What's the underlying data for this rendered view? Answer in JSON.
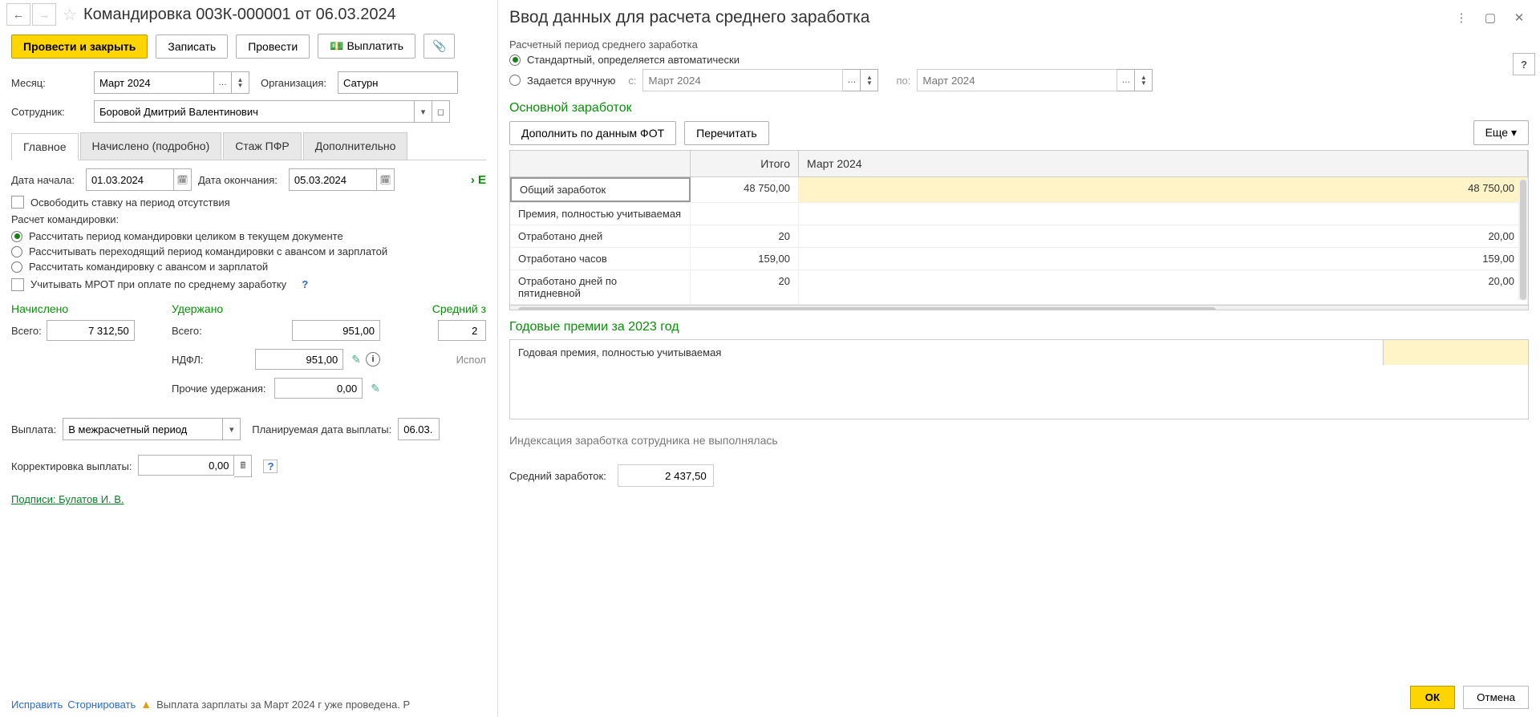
{
  "doc": {
    "title": "Командировка 003К-000001 от 06.03.2024",
    "toolbar": {
      "post_close": "Провести и закрыть",
      "save": "Записать",
      "post": "Провести",
      "pay": "Выплатить"
    },
    "fields": {
      "month_label": "Месяц:",
      "month_value": "Март 2024",
      "org_label": "Организация:",
      "org_value": "Сатурн",
      "employee_label": "Сотрудник:",
      "employee_value": "Боровой Дмитрий Валентинович"
    },
    "tabs": {
      "t1": "Главное",
      "t2": "Начислено (подробно)",
      "t3": "Стаж ПФР",
      "t4": "Дополнительно"
    },
    "main": {
      "date_start_label": "Дата начала:",
      "date_start": "01.03.2024",
      "date_end_label": "Дата окончания:",
      "date_end": "05.03.2024",
      "free_rate": "Освободить ставку на период отсутствия",
      "calc_header": "Расчет командировки:",
      "calc_r1": "Рассчитать период командировки целиком в текущем документе",
      "calc_r2": "Рассчитывать переходящий период командировки с авансом и зарплатой",
      "calc_r3": "Рассчитать командировку с авансом и зарплатой",
      "mrot": "Учитывать МРОТ при оплате по среднему заработку",
      "col_accrued": "Начислено",
      "col_withheld": "Удержано",
      "col_avg": "Средний з",
      "total_label": "Всего:",
      "total_accrued": "7 312,50",
      "total_withheld": "951,00",
      "total_avg_partial": "2 ",
      "ndfl_label": "НДФЛ:",
      "ndfl_value": "951,00",
      "other_label": "Прочие удержания:",
      "other_value": "0,00",
      "ispol_label": "Испол",
      "payout_label": "Выплата:",
      "payout_value": "В межрасчетный период",
      "planned_label": "Планируемая дата выплаты:",
      "planned_value": "06.03.",
      "corr_label": "Корректировка выплаты:",
      "corr_value": "0,00",
      "signatures": "Подписи: Булатов И. В.",
      "fix": "Исправить",
      "storno": "Сторнировать",
      "warn": "Выплата зарплаты за Март 2024 г уже проведена. Р"
    }
  },
  "dialog": {
    "title": "Ввод данных для расчета среднего заработка",
    "period_section": "Расчетный период среднего заработка",
    "period_r1": "Стандартный, определяется автоматически",
    "period_r2": "Задается вручную",
    "from_label": "с:",
    "from_value": "Март 2024",
    "to_label": "по:",
    "to_value": "Март 2024",
    "main_section": "Основной заработок",
    "btn_fill": "Дополнить по данным ФОТ",
    "btn_recalc": "Перечитать",
    "btn_more": "Еще",
    "grid": {
      "head_total": "Итого",
      "head_month": "Март 2024",
      "rows": [
        {
          "label": "Общий заработок",
          "total": "48 750,00",
          "month": "48 750,00",
          "hl": true,
          "sel": true
        },
        {
          "label": "Премия, полностью учитываемая",
          "total": "",
          "month": ""
        },
        {
          "label": "Отработано дней",
          "total": "20",
          "month": "20,00"
        },
        {
          "label": "Отработано часов",
          "total": "159,00",
          "month": "159,00"
        },
        {
          "label": "Отработано дней по пятидневной",
          "total": "20",
          "month": "20,00"
        }
      ]
    },
    "bonus_section": "Годовые премии за 2023 год",
    "bonus_row_label": "Годовая премия, полностью учитываемая",
    "index_note": "Индексация заработка сотрудника не выполнялась",
    "avg_label": "Средний заработок:",
    "avg_value": "2 437,50",
    "ok": "ОК",
    "cancel": "Отмена",
    "help": "?"
  }
}
